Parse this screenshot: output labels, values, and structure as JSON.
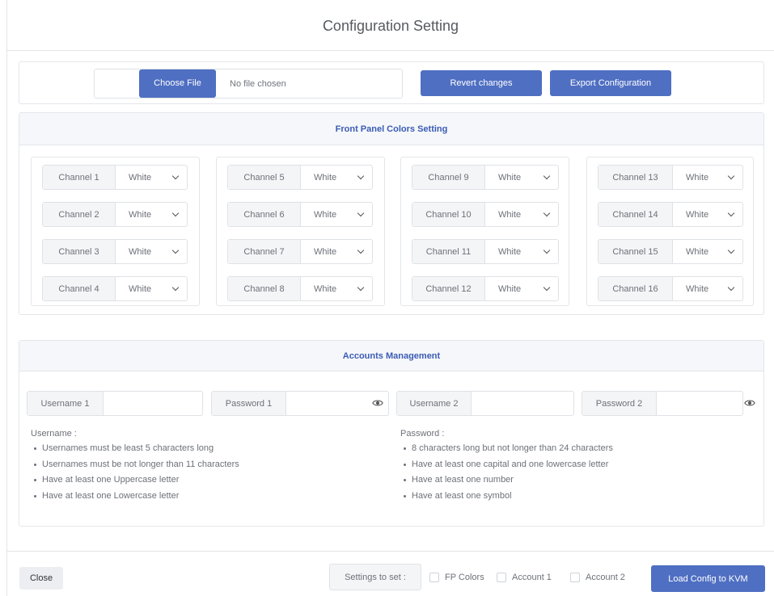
{
  "modal": {
    "title": "Configuration Setting"
  },
  "file": {
    "choose_label": "Choose File",
    "file_status": "No file chosen",
    "revert_label": "Revert changes",
    "export_label": "Export Configuration"
  },
  "front_panel": {
    "heading": "Front Panel Colors Setting",
    "groups": [
      [
        {
          "label": "Channel 1",
          "value": "White"
        },
        {
          "label": "Channel 2",
          "value": "White"
        },
        {
          "label": "Channel 3",
          "value": "White"
        },
        {
          "label": "Channel 4",
          "value": "White"
        }
      ],
      [
        {
          "label": "Channel 5",
          "value": "White"
        },
        {
          "label": "Channel 6",
          "value": "White"
        },
        {
          "label": "Channel 7",
          "value": "White"
        },
        {
          "label": "Channel 8",
          "value": "White"
        }
      ],
      [
        {
          "label": "Channel 9",
          "value": "White"
        },
        {
          "label": "Channel 10",
          "value": "White"
        },
        {
          "label": "Channel 11",
          "value": "White"
        },
        {
          "label": "Channel 12",
          "value": "White"
        }
      ],
      [
        {
          "label": "Channel 13",
          "value": "White"
        },
        {
          "label": "Channel 14",
          "value": "White"
        },
        {
          "label": "Channel 15",
          "value": "White"
        },
        {
          "label": "Channel 16",
          "value": "White"
        }
      ]
    ]
  },
  "accounts": {
    "heading": "Accounts Management",
    "username1_label": "Username 1",
    "password1_label": "Password 1",
    "username2_label": "Username 2",
    "password2_label": "Password 2",
    "username_rules_title": "Username :",
    "username_rules": [
      "Usernames must be least 5 characters long",
      "Usernames must be not longer than 11 characters",
      "Have at least one Uppercase letter",
      "Have at least one Lowercase letter"
    ],
    "password_rules_title": "Password :",
    "password_rules": [
      "8 characters long but not longer than 24 characters",
      "Have at least one capital and one lowercase letter",
      "Have at least one number",
      "Have at least one symbol"
    ]
  },
  "footer": {
    "close_label": "Close",
    "settings_label": "Settings to set :",
    "fp_colors_label": "FP Colors",
    "account1_label": "Account 1",
    "account2_label": "Account 2",
    "load_label": "Load Config to KVM"
  },
  "colors": {
    "primary": "#4f6fc2",
    "heading": "#3b5bb5"
  }
}
